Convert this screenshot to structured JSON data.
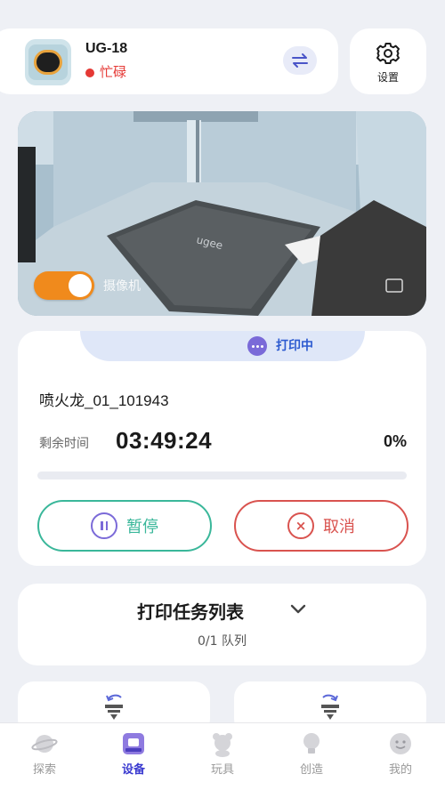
{
  "device": {
    "name": "UG-18",
    "status": "忙碌",
    "status_color": "#e53935"
  },
  "settings": {
    "label": "设置"
  },
  "camera": {
    "label": "摄像机",
    "toggle_on": true,
    "toggle_color": "#f08a1c",
    "bed_brand": "ugee"
  },
  "print": {
    "status": "打印中",
    "file_name": "喷火龙_01_101943",
    "remaining_label": "剩余时间",
    "remaining_time": "03:49:24",
    "progress_text": "0%",
    "progress": 0,
    "pause_label": "暂停",
    "cancel_label": "取消"
  },
  "task_list": {
    "title": "打印任务列表",
    "count": "0/1 队列"
  },
  "nav": {
    "items": [
      {
        "label": "探索",
        "icon": "planet-icon"
      },
      {
        "label": "设备",
        "icon": "device-icon"
      },
      {
        "label": "玩具",
        "icon": "bear-icon"
      },
      {
        "label": "创造",
        "icon": "bulb-icon"
      },
      {
        "label": "我的",
        "icon": "face-icon"
      }
    ],
    "active": "设备"
  },
  "colors": {
    "accent": "#3b3bd0",
    "pause": "#3ab79a",
    "cancel": "#d9534f"
  }
}
